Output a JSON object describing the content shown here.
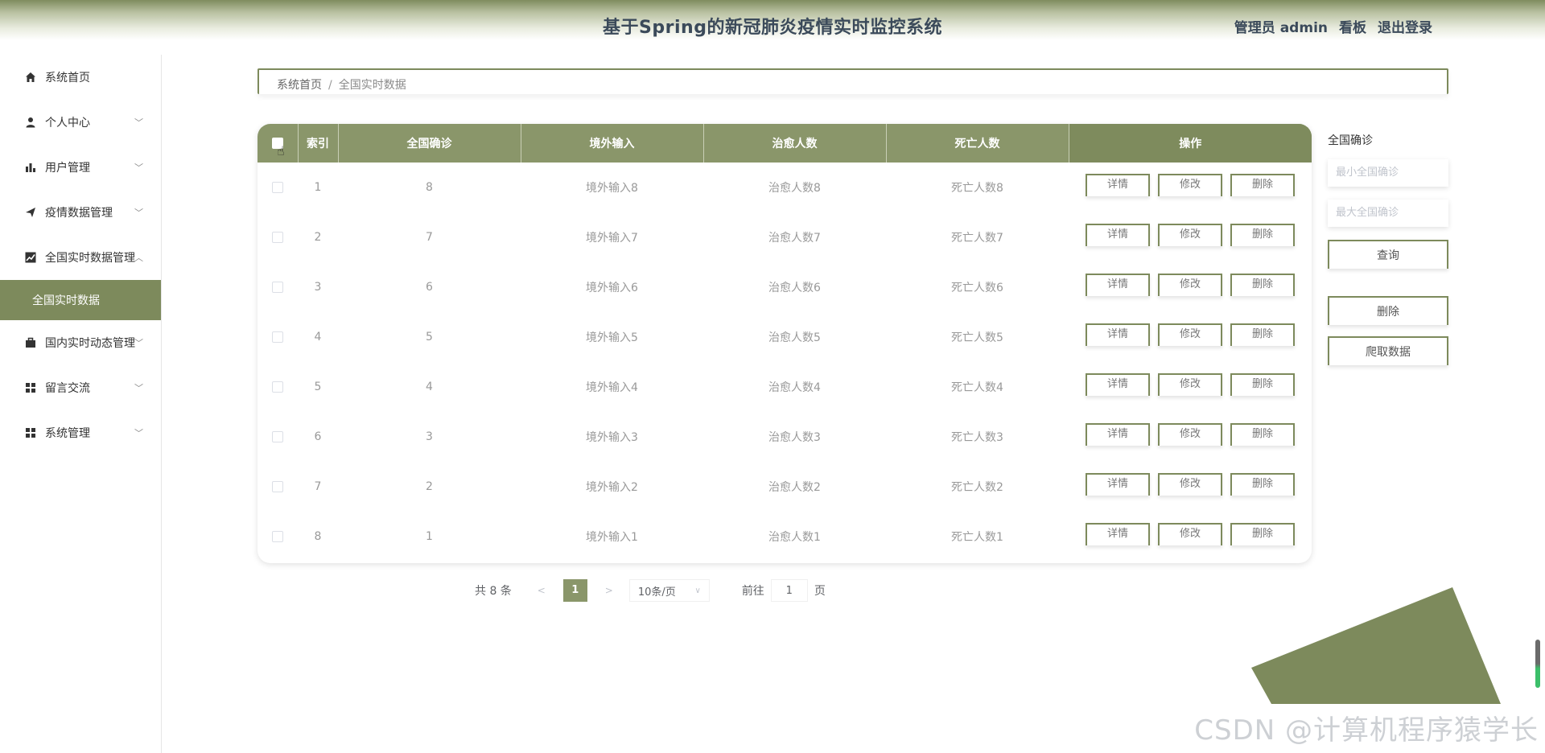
{
  "header": {
    "title": "基于Spring的新冠肺炎疫情实时监控系统",
    "user": "管理员 admin",
    "board": "看板",
    "logout": "退出登录"
  },
  "sidebar": {
    "items": [
      {
        "label": "系统首页",
        "icon": "home-icon"
      },
      {
        "label": "个人中心",
        "icon": "user-icon"
      },
      {
        "label": "用户管理",
        "icon": "bar-chart-icon"
      },
      {
        "label": "疫情数据管理",
        "icon": "send-icon"
      },
      {
        "label": "全国实时数据管理",
        "icon": "line-chart-icon"
      },
      {
        "label": "全国实时数据",
        "icon": ""
      },
      {
        "label": "国内实时动态管理",
        "icon": "briefcase-icon"
      },
      {
        "label": "留言交流",
        "icon": "grid-icon"
      },
      {
        "label": "系统管理",
        "icon": "grid-icon"
      }
    ]
  },
  "breadcrumb": {
    "home": "系统首页",
    "sep": "/",
    "current": "全国实时数据"
  },
  "table": {
    "headers": [
      "索引",
      "全国确诊",
      "境外输入",
      "治愈人数",
      "死亡人数",
      "操作"
    ],
    "rows": [
      {
        "index": "1",
        "confirmed": "8",
        "imported": "境外输入8",
        "cured": "治愈人数8",
        "dead": "死亡人数8"
      },
      {
        "index": "2",
        "confirmed": "7",
        "imported": "境外输入7",
        "cured": "治愈人数7",
        "dead": "死亡人数7"
      },
      {
        "index": "3",
        "confirmed": "6",
        "imported": "境外输入6",
        "cured": "治愈人数6",
        "dead": "死亡人数6"
      },
      {
        "index": "4",
        "confirmed": "5",
        "imported": "境外输入5",
        "cured": "治愈人数5",
        "dead": "死亡人数5"
      },
      {
        "index": "5",
        "confirmed": "4",
        "imported": "境外输入4",
        "cured": "治愈人数4",
        "dead": "死亡人数4"
      },
      {
        "index": "6",
        "confirmed": "3",
        "imported": "境外输入3",
        "cured": "治愈人数3",
        "dead": "死亡人数3"
      },
      {
        "index": "7",
        "confirmed": "2",
        "imported": "境外输入2",
        "cured": "治愈人数2",
        "dead": "死亡人数2"
      },
      {
        "index": "8",
        "confirmed": "1",
        "imported": "境外输入1",
        "cured": "治愈人数1",
        "dead": "死亡人数1"
      }
    ],
    "actions": {
      "detail": "详情",
      "edit": "修改",
      "delete": "删除"
    }
  },
  "pagination": {
    "total": "共 8 条",
    "prev": "<",
    "page": "1",
    "next": ">",
    "page_size": "10条/页",
    "goto_label": "前往",
    "goto_value": "1",
    "page_suffix": "页"
  },
  "search": {
    "label": "全国确诊",
    "min_placeholder": "最小全国确诊",
    "max_placeholder": "最大全国确诊",
    "query_button": "查询",
    "delete_button": "删除",
    "crawl_button": "爬取数据"
  },
  "watermark": "CSDN @计算机程序猿学长",
  "colors": {
    "accent": "#8a966a",
    "accent_dark": "#7d8a5c",
    "header_text": "#3b4a5a"
  }
}
